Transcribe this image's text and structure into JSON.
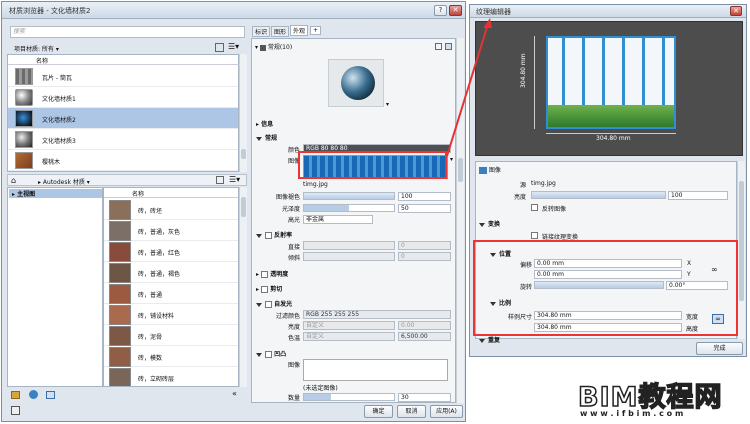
{
  "main_window": {
    "title": "材质浏览器 - 文化墙材质2",
    "search_placeholder": "搜索",
    "filter_label": "项目材质: 所有",
    "col_name": "名称",
    "materials": [
      "瓦片 - 筒瓦",
      "文化墙材质1",
      "文化墙材质2",
      "文化墙材质3",
      "樱桃木"
    ],
    "library_label": "Autodesk 材质",
    "home_item": "主视图",
    "library_materials": [
      "砖，砖坯",
      "砖，普通，灰色",
      "砖，普通，红色",
      "砖，普通，褐色",
      "砖，普通",
      "砖，铺设材料",
      "砖，泥骨",
      "砖，模数",
      "砖，立砌砖层"
    ],
    "tabs": [
      "标识",
      "图形",
      "外观"
    ],
    "tab_plus": "+",
    "asset_name": "常规(10)",
    "sections": {
      "info": "信息",
      "general": "常规",
      "reflect": "反射率",
      "transparency": "透明度",
      "cutout": "剪切",
      "selfillum": "自发光",
      "bump": "凹凸"
    },
    "general": {
      "color_label": "颜色",
      "color_value": "RGB 80 80 80",
      "image_label": "图像",
      "image_name": "timg.jpg",
      "fade_label": "图像褪色",
      "fade_value": "100",
      "gloss_label": "光泽度",
      "gloss_value": "50",
      "highlight_label": "高光",
      "highlight_value": "非金属"
    },
    "reflect": {
      "direct_label": "直接",
      "direct_value": "0",
      "oblique_label": "倾斜",
      "oblique_value": "0"
    },
    "selfillum": {
      "filter_label": "过滤颜色",
      "filter_value": "RGB 255 255 255",
      "lum_label": "亮度",
      "lum_value": "0.00",
      "lum_mode": "自定义",
      "temp_label": "色温",
      "temp_value": "6,500.00",
      "temp_mode": "自定义"
    },
    "bump": {
      "image_label": "图像",
      "no_image": "(未选定图像)",
      "amount_label": "数量",
      "amount_value": "30"
    },
    "buttons": {
      "ok": "确定",
      "cancel": "取消",
      "apply": "应用(A)"
    }
  },
  "texture_editor": {
    "title": "纹理编辑器",
    "dim_h": "304.80 mm",
    "dim_v": "304.80 mm",
    "image_section": "图像",
    "source_label": "源",
    "source_value": "timg.jpg",
    "brightness_label": "亮度",
    "brightness_value": "100",
    "invert_label": "反转图像",
    "transform_section": "变换",
    "link_label": "链接纹理变换",
    "position_section": "位置",
    "offset_label": "偏移",
    "offset_x": "0.00 mm",
    "axis_x": "X",
    "offset_y": "0.00 mm",
    "axis_y": "Y",
    "rotation_label": "旋转",
    "rotation_value": "0.00°",
    "scale_section": "比例",
    "sample_label": "样例尺寸",
    "width_value": "304.80 mm",
    "width_label": "宽度",
    "height_value": "304.80 mm",
    "height_label": "高度",
    "repeat_section": "重复",
    "done": "完成"
  },
  "watermark": {
    "logo": "BIM教程网",
    "url": "w w w . i f b i m . c o m"
  },
  "colors": {
    "accent": "#e33333",
    "selection": "#aec6e6",
    "title": "#dfe6ee",
    "texture_bg": "#4d4d4d"
  }
}
